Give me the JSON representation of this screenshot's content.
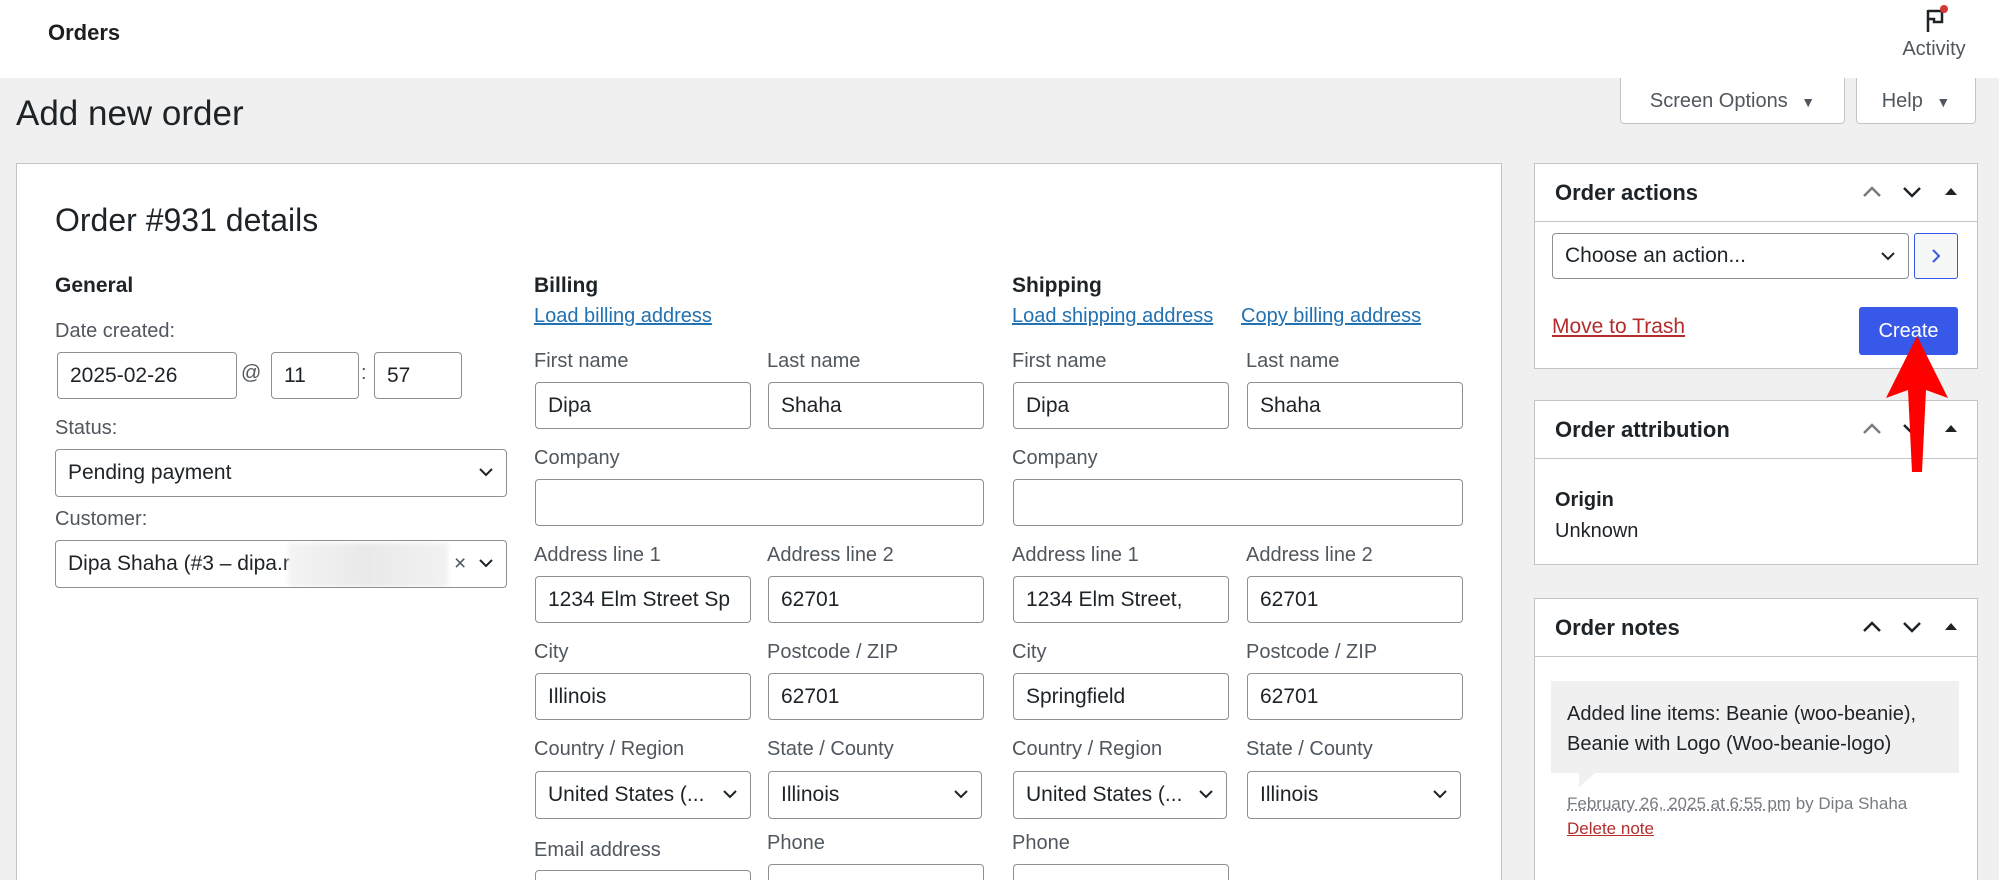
{
  "topbar": {
    "title": "Orders",
    "activity_label": "Activity"
  },
  "header": {
    "screen_options": "Screen Options",
    "help": "Help"
  },
  "page_title": "Add new order",
  "order": {
    "heading": "Order #931 details",
    "general": {
      "heading": "General",
      "date_label": "Date created:",
      "date": "2025-02-26",
      "at": "@",
      "hour": "11",
      "colon": ":",
      "minute": "57",
      "status_label": "Status:",
      "status": "Pending payment",
      "customer_label": "Customer:",
      "customer": "Dipa Shaha (#3 – dipa.r",
      "clear": "×"
    },
    "billing": {
      "heading": "Billing",
      "load_link": "Load billing address",
      "first_name_label": "First name",
      "first_name": "Dipa",
      "last_name_label": "Last name",
      "last_name": "Shaha",
      "company_label": "Company",
      "company": "",
      "addr1_label": "Address line 1",
      "addr1": "1234 Elm Street Sp",
      "addr2_label": "Address line 2",
      "addr2": "62701",
      "city_label": "City",
      "city": "Illinois",
      "postcode_label": "Postcode / ZIP",
      "postcode": "62701",
      "country_label": "Country / Region",
      "country": "United States (...",
      "state_label": "State / County",
      "state": "Illinois",
      "email_label": "Email address",
      "phone_label": "Phone"
    },
    "shipping": {
      "heading": "Shipping",
      "load_link": "Load shipping address",
      "copy_link": "Copy billing address",
      "first_name_label": "First name",
      "first_name": "Dipa",
      "last_name_label": "Last name",
      "last_name": "Shaha",
      "company_label": "Company",
      "company": "",
      "addr1_label": "Address line 1",
      "addr1": "1234 Elm Street,",
      "addr2_label": "Address line 2",
      "addr2": "62701",
      "city_label": "City",
      "city": "Springfield",
      "postcode_label": "Postcode / ZIP",
      "postcode": "62701",
      "country_label": "Country / Region",
      "country": "United States (...",
      "state_label": "State / County",
      "state": "Illinois",
      "phone_label": "Phone"
    }
  },
  "sidebar": {
    "order_actions": {
      "title": "Order actions",
      "select": "Choose an action...",
      "trash": "Move to Trash",
      "create": "Create"
    },
    "attribution": {
      "title": "Order attribution",
      "origin_label": "Origin",
      "origin": "Unknown"
    },
    "notes": {
      "title": "Order notes",
      "note": "Added line items: Beanie (woo-beanie), Beanie with Logo (Woo-beanie-logo)",
      "date": "February 26, 2025 at 6:55 pm",
      "by": " by Dipa Shaha",
      "delete": "Delete note"
    }
  },
  "colors": {
    "accent": "#3858e9",
    "link": "#2271b1",
    "danger": "#b32d2e",
    "annotation_arrow": "#ff0000"
  },
  "icons": [
    "flag-icon",
    "chevron-down-icon",
    "chevron-up-icon",
    "triangle-up-icon",
    "chevron-right-icon",
    "red-arrow-annotation"
  ]
}
